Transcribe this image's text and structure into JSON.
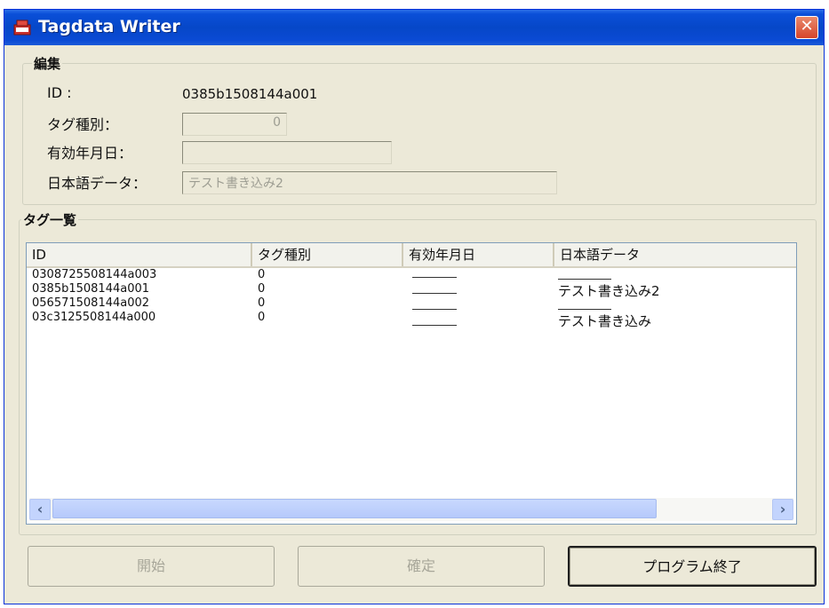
{
  "window": {
    "title": "Tagdata Writer",
    "close_glyph": "✕"
  },
  "edit_group": {
    "legend": "編集",
    "id_label": "ID :",
    "id_value": "0385b1508144a001",
    "tag_type_label": "タグ種別：",
    "tag_type_value": "0",
    "expiry_label": "有効年月日：",
    "expiry_value": "",
    "japanese_label": "日本語データ：",
    "japanese_value": "テスト書き込み2"
  },
  "tag_list": {
    "legend": "タグ一覧",
    "columns": [
      "ID",
      "タグ種別",
      "有効年月日",
      "日本語データ"
    ],
    "rows": [
      {
        "id": "0308725508144a003",
        "type": "0",
        "expiry": "",
        "japanese": ""
      },
      {
        "id": "0385b1508144a001",
        "type": "0",
        "expiry": "",
        "japanese": "テスト書き込み2"
      },
      {
        "id": "056571508144a002",
        "type": "0",
        "expiry": "",
        "japanese": ""
      },
      {
        "id": "03c3125508144a000",
        "type": "0",
        "expiry": "",
        "japanese": "テスト書き込み"
      }
    ],
    "scroll_left": "‹",
    "scroll_right": "›"
  },
  "buttons": {
    "start": "開始",
    "confirm": "確定",
    "exit": "プログラム終了"
  },
  "icons": {
    "app": "app-window-icon",
    "close": "close-icon"
  },
  "colors": {
    "titlebar": "#0a4fd8",
    "window_bg": "#ece9d8",
    "close_btn": "#d6442a",
    "scroll_thumb": "#c3d4fd"
  }
}
